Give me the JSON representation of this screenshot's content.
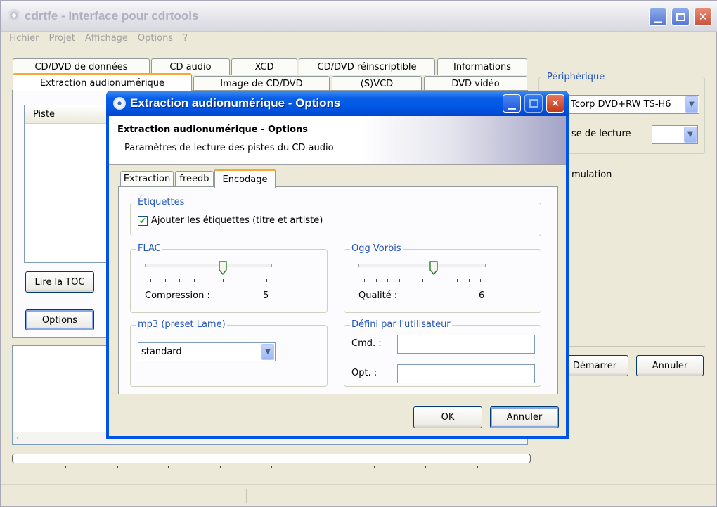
{
  "main_window": {
    "title": "cdrtfe - Interface pour cdrtools",
    "menu": [
      "Fichier",
      "Projet",
      "Affichage",
      "Options",
      "?"
    ],
    "tabs_row1": [
      "CD/DVD de données",
      "CD audio",
      "XCD",
      "CD/DVD réinscriptible",
      "Informations"
    ],
    "tabs_row2": [
      "Extraction audionumérique",
      "Image de CD/DVD",
      "(S)VCD",
      "DVD vidéo"
    ],
    "track_list_header": "Piste",
    "read_toc_button": "Lire la TOC",
    "options_button": "Options",
    "device_group_label": "Périphérique",
    "device_value": "Tcorp DVD+RW TS-H6",
    "read_speed_label": "se de lecture",
    "simulation_label": "mulation",
    "start_button": "Démarrer",
    "cancel_button": "Annuler"
  },
  "dialog": {
    "title": "Extraction audionumérique - Options",
    "header_title": "Extraction audionumérique - Options",
    "header_subtitle": "Paramètres de lecture des pistes du CD audio",
    "tabs": [
      "Extraction",
      "freedb",
      "Encodage"
    ],
    "active_tab": "Encodage",
    "labels_group": {
      "legend": "Étiquettes",
      "checkbox_label": "Ajouter les étiquettes (titre et artiste)",
      "checked": true
    },
    "flac_group": {
      "legend": "FLAC",
      "caption": "Compression :",
      "value": "5",
      "level": 5,
      "max": 8
    },
    "ogg_group": {
      "legend": "Ogg Vorbis",
      "caption": "Qualité :",
      "value": "6",
      "level": 6,
      "max": 10
    },
    "mp3_group": {
      "legend": "mp3 (preset Lame)",
      "selected": "standard"
    },
    "user_group": {
      "legend": "Défini par l'utilisateur",
      "cmd_label": "Cmd. :",
      "cmd_value": "",
      "opt_label": "Opt. :",
      "opt_value": ""
    },
    "ok_button": "OK",
    "cancel_button": "Annuler"
  },
  "colors": {
    "title_active": "#0054e3",
    "group_label": "#2456b8",
    "tab_accent": "#f3a83a",
    "window_bg": "#ece9d8"
  }
}
